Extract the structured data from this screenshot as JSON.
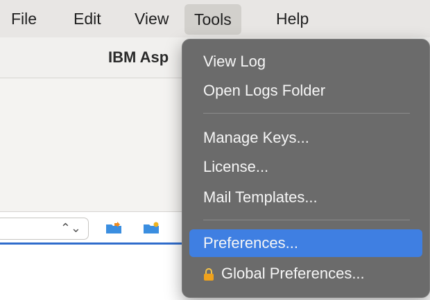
{
  "menubar": {
    "items": [
      {
        "label": "File"
      },
      {
        "label": "Edit"
      },
      {
        "label": "View"
      },
      {
        "label": "Tools",
        "active": true
      },
      {
        "label": "Help"
      }
    ]
  },
  "window": {
    "title": "IBM Asp"
  },
  "tools_menu": {
    "items": [
      {
        "label": "View Log"
      },
      {
        "label": "Open Logs Folder"
      },
      {
        "label": "Manage Keys..."
      },
      {
        "label": "License..."
      },
      {
        "label": "Mail Templates..."
      },
      {
        "label": "Preferences...",
        "highlighted": true
      },
      {
        "label": "Global Preferences...",
        "icon": "lock-icon"
      }
    ]
  },
  "colors": {
    "menu_bg": "#6b6b6b",
    "highlight": "#3f7fe2",
    "accent_line": "#2f6ccc"
  }
}
